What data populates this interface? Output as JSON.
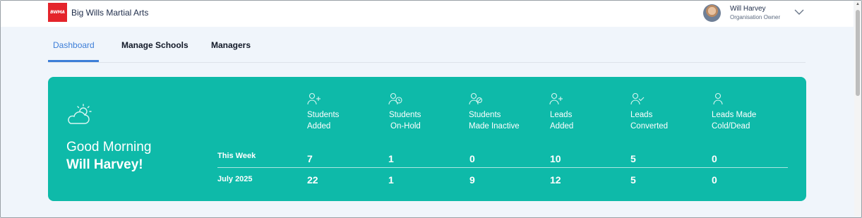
{
  "header": {
    "logo_text": "BWMA",
    "brand": "Big Wills Martial Arts",
    "user_name": "Will Harvey",
    "user_role": "Organisation Owner"
  },
  "tabs": [
    {
      "label": "Dashboard",
      "active": true
    },
    {
      "label": "Manage Schools",
      "active": false
    },
    {
      "label": "Managers",
      "active": false
    }
  ],
  "card": {
    "greeting": "Good Morning",
    "name": "Will Harvey!",
    "rows": [
      {
        "label": "This Week"
      },
      {
        "label": "July 2025"
      }
    ],
    "stats": [
      {
        "line1": "Students",
        "line2": "Added",
        "icon": "user-plus-icon",
        "this_week": "7",
        "month": "22"
      },
      {
        "line1": "Students",
        "line2": "On-Hold",
        "icon": "user-clock-icon",
        "this_week": "1",
        "month": "1"
      },
      {
        "line1": "Students",
        "line2": "Made Inactive",
        "icon": "user-inactive-icon",
        "this_week": "0",
        "month": "9"
      },
      {
        "line1": "Leads",
        "line2": "Added",
        "icon": "user-plus-icon",
        "this_week": "10",
        "month": "12"
      },
      {
        "line1": "Leads",
        "line2": "Converted",
        "icon": "user-check-icon",
        "this_week": "5",
        "month": "5"
      },
      {
        "line1": "Leads Made",
        "line2": "Cold/Dead",
        "icon": "user-icon",
        "this_week": "0",
        "month": "0"
      }
    ]
  },
  "colors": {
    "accent": "#3d7ed8",
    "card": "#0ebaa9",
    "logo": "#e4242b"
  }
}
